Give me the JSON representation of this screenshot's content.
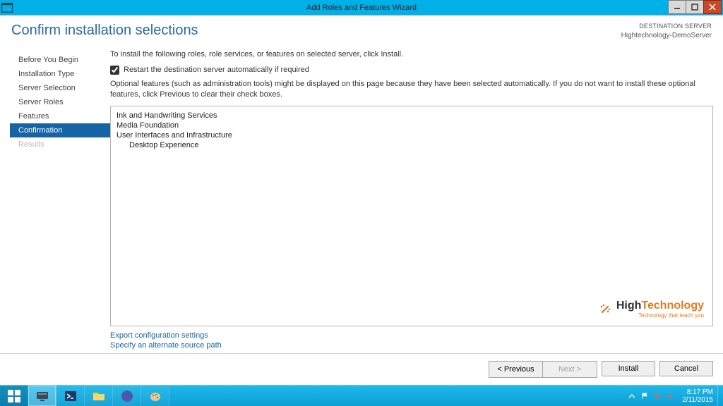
{
  "titlebar": {
    "title": "Add Roles and Features Wizard"
  },
  "header": {
    "page_title": "Confirm installation selections",
    "destination_label": "DESTINATION SERVER",
    "destination_server": "Hightechnology-DemoServer"
  },
  "sidebar": {
    "steps": [
      {
        "label": "Before You Begin",
        "state": "normal"
      },
      {
        "label": "Installation Type",
        "state": "normal"
      },
      {
        "label": "Server Selection",
        "state": "normal"
      },
      {
        "label": "Server Roles",
        "state": "normal"
      },
      {
        "label": "Features",
        "state": "normal"
      },
      {
        "label": "Confirmation",
        "state": "active"
      },
      {
        "label": "Results",
        "state": "disabled"
      }
    ]
  },
  "main": {
    "intro": "To install the following roles, role services, or features on selected server, click Install.",
    "restart_label": "Restart the destination server automatically if required",
    "restart_checked": true,
    "optional": "Optional features (such as administration tools) might be displayed on this page because they have been selected automatically. If you do not want to install these optional features, click Previous to clear their check boxes.",
    "items": [
      {
        "label": "Ink and Handwriting Services",
        "indent": 0
      },
      {
        "label": "Media Foundation",
        "indent": 0
      },
      {
        "label": "User Interfaces and Infrastructure",
        "indent": 0
      },
      {
        "label": "Desktop Experience",
        "indent": 1
      }
    ],
    "link_export": "Export configuration settings",
    "link_altpath": "Specify an alternate source path"
  },
  "buttons": {
    "previous": "< Previous",
    "next": "Next >",
    "install": "Install",
    "cancel": "Cancel"
  },
  "watermark": {
    "text_prefix": "High",
    "text_suffix": "Technology",
    "tagline": "Technology that teach you"
  },
  "taskbar": {
    "time": "8:17 PM",
    "date": "2/11/2015"
  }
}
